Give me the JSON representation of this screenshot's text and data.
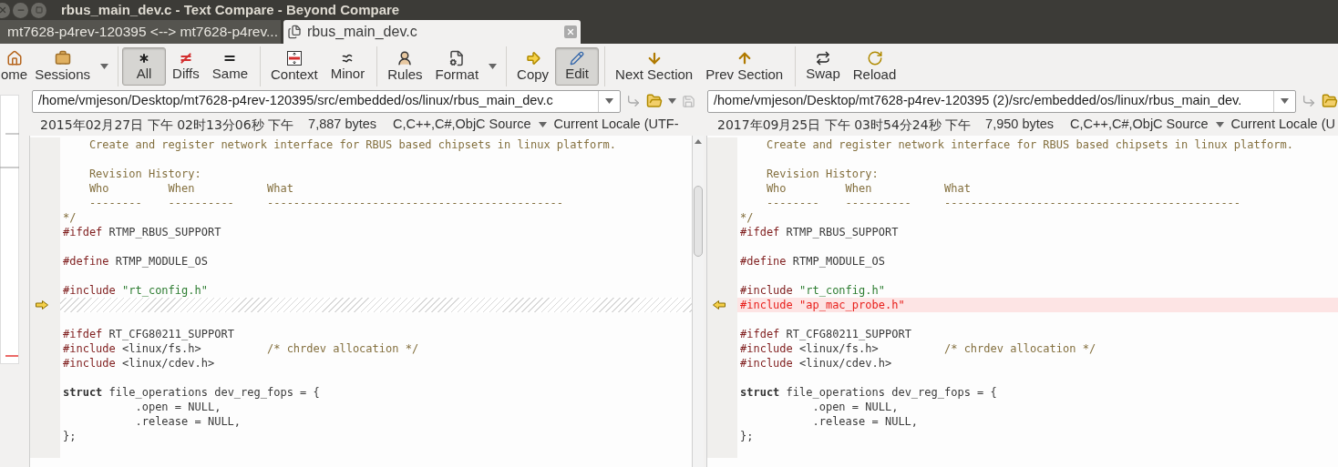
{
  "window": {
    "title": "rbus_main_dev.c - Text Compare - Beyond Compare"
  },
  "tabs": [
    {
      "label": "mt7628-p4rev-120395 <--> mt7628-p4rev...",
      "selected": false
    },
    {
      "label": "rbus_main_dev.c",
      "selected": true
    }
  ],
  "toolbar": {
    "groups": [
      [
        {
          "label": "ome",
          "selected": false,
          "dropdown": false
        },
        {
          "label": "Sessions",
          "selected": false,
          "dropdown": true
        }
      ],
      [
        {
          "label": "All",
          "selected": true,
          "dropdown": false
        },
        {
          "label": "Diffs",
          "selected": false,
          "dropdown": false
        },
        {
          "label": "Same",
          "selected": false,
          "dropdown": false
        }
      ],
      [
        {
          "label": "Context",
          "selected": false,
          "dropdown": false
        },
        {
          "label": "Minor",
          "selected": false,
          "dropdown": false
        }
      ],
      [
        {
          "label": "Rules",
          "selected": false,
          "dropdown": false
        },
        {
          "label": "Format",
          "selected": false,
          "dropdown": true
        }
      ],
      [
        {
          "label": "Copy",
          "selected": false,
          "dropdown": false
        },
        {
          "label": "Edit",
          "selected": true,
          "dropdown": false
        }
      ],
      [
        {
          "label": "Next Section",
          "selected": false,
          "dropdown": false
        },
        {
          "label": "Prev Section",
          "selected": false,
          "dropdown": false
        }
      ],
      [
        {
          "label": "Swap",
          "selected": false,
          "dropdown": false
        },
        {
          "label": "Reload",
          "selected": false,
          "dropdown": false
        }
      ]
    ]
  },
  "panes": [
    {
      "path": "/home/vmjeson/Desktop/mt7628-p4rev-120395/src/embedded/os/linux/rbus_main_dev.c",
      "date": "2015年02月27日 下午 02时13分06秒 下午",
      "size": "7,887 bytes",
      "format": "C,C++,C#,ObjC Source",
      "encoding": "Current Locale (UTF-",
      "lines": [
        {
          "kind": "code",
          "marker": false,
          "segments": [
            {
              "kind": "comment",
              "text": "    Create and register network interface for RBUS based chipsets in linux platform."
            }
          ]
        },
        {
          "kind": "blank",
          "marker": false
        },
        {
          "kind": "code",
          "marker": false,
          "segments": [
            {
              "kind": "comment",
              "text": "    Revision History:"
            }
          ]
        },
        {
          "kind": "code",
          "marker": false,
          "segments": [
            {
              "kind": "comment",
              "text": "    Who         When           What"
            }
          ]
        },
        {
          "kind": "code",
          "marker": false,
          "segments": [
            {
              "kind": "comment",
              "text": "    --------    ----------     ---------------------------------------------"
            }
          ]
        },
        {
          "kind": "code",
          "marker": false,
          "segments": [
            {
              "kind": "comment",
              "text": "*/"
            }
          ]
        },
        {
          "kind": "code",
          "marker": false,
          "segments": [
            {
              "kind": "directive",
              "text": "#ifdef"
            },
            {
              "kind": "plain",
              "text": " RTMP_RBUS_SUPPORT"
            }
          ]
        },
        {
          "kind": "blank",
          "marker": false
        },
        {
          "kind": "code",
          "marker": false,
          "segments": [
            {
              "kind": "directive",
              "text": "#define"
            },
            {
              "kind": "plain",
              "text": " RTMP_MODULE_OS"
            }
          ]
        },
        {
          "kind": "blank",
          "marker": false
        },
        {
          "kind": "code",
          "marker": false,
          "segments": [
            {
              "kind": "directive",
              "text": "#include"
            },
            {
              "kind": "string",
              "text": " \"rt_config.h\""
            }
          ]
        },
        {
          "kind": "missing",
          "marker": true
        },
        {
          "kind": "blank",
          "marker": false
        },
        {
          "kind": "code",
          "marker": false,
          "segments": [
            {
              "kind": "directive",
              "text": "#ifdef"
            },
            {
              "kind": "plain",
              "text": " RT_CFG80211_SUPPORT"
            }
          ]
        },
        {
          "kind": "code",
          "marker": false,
          "segments": [
            {
              "kind": "directive",
              "text": "#include"
            },
            {
              "kind": "plain",
              "text": " <linux/fs.h>          "
            },
            {
              "kind": "comment",
              "text": "/* chrdev allocation */"
            }
          ]
        },
        {
          "kind": "code",
          "marker": false,
          "segments": [
            {
              "kind": "directive",
              "text": "#include"
            },
            {
              "kind": "plain",
              "text": " <linux/cdev.h>"
            }
          ]
        },
        {
          "kind": "blank",
          "marker": false
        },
        {
          "kind": "code",
          "marker": false,
          "segments": [
            {
              "kind": "keyword",
              "text": "struct"
            },
            {
              "kind": "plain",
              "text": " file_operations dev_reg_fops = {"
            }
          ]
        },
        {
          "kind": "code",
          "marker": false,
          "segments": [
            {
              "kind": "plain",
              "text": "           .open = NULL,"
            }
          ]
        },
        {
          "kind": "code",
          "marker": false,
          "segments": [
            {
              "kind": "plain",
              "text": "           .release = NULL,"
            }
          ]
        },
        {
          "kind": "code",
          "marker": false,
          "segments": [
            {
              "kind": "plain",
              "text": "};"
            }
          ]
        },
        {
          "kind": "blank",
          "marker": false
        }
      ]
    },
    {
      "path": "/home/vmjeson/Desktop/mt7628-p4rev-120395 (2)/src/embedded/os/linux/rbus_main_dev.",
      "date": "2017年09月25日 下午 03时54分24秒 下午",
      "size": "7,950 bytes",
      "format": "C,C++,C#,ObjC Source",
      "encoding": "Current Locale (U",
      "lines": [
        {
          "kind": "code",
          "marker": false,
          "segments": [
            {
              "kind": "comment",
              "text": "    Create and register network interface for RBUS based chipsets in linux platform."
            }
          ]
        },
        {
          "kind": "blank",
          "marker": false
        },
        {
          "kind": "code",
          "marker": false,
          "segments": [
            {
              "kind": "comment",
              "text": "    Revision History:"
            }
          ]
        },
        {
          "kind": "code",
          "marker": false,
          "segments": [
            {
              "kind": "comment",
              "text": "    Who         When           What"
            }
          ]
        },
        {
          "kind": "code",
          "marker": false,
          "segments": [
            {
              "kind": "comment",
              "text": "    --------    ----------     ---------------------------------------------"
            }
          ]
        },
        {
          "kind": "code",
          "marker": false,
          "segments": [
            {
              "kind": "comment",
              "text": "*/"
            }
          ]
        },
        {
          "kind": "code",
          "marker": false,
          "segments": [
            {
              "kind": "directive",
              "text": "#ifdef"
            },
            {
              "kind": "plain",
              "text": " RTMP_RBUS_SUPPORT"
            }
          ]
        },
        {
          "kind": "blank",
          "marker": false
        },
        {
          "kind": "code",
          "marker": false,
          "segments": [
            {
              "kind": "directive",
              "text": "#define"
            },
            {
              "kind": "plain",
              "text": " RTMP_MODULE_OS"
            }
          ]
        },
        {
          "kind": "blank",
          "marker": false
        },
        {
          "kind": "code",
          "marker": false,
          "segments": [
            {
              "kind": "directive",
              "text": "#include"
            },
            {
              "kind": "string",
              "text": " \"rt_config.h\""
            }
          ]
        },
        {
          "kind": "added",
          "marker": true,
          "segments": [
            {
              "kind": "plain",
              "text": "#include \"ap_mac_probe.h\""
            }
          ]
        },
        {
          "kind": "blank",
          "marker": false
        },
        {
          "kind": "code",
          "marker": false,
          "segments": [
            {
              "kind": "directive",
              "text": "#ifdef"
            },
            {
              "kind": "plain",
              "text": " RT_CFG80211_SUPPORT"
            }
          ]
        },
        {
          "kind": "code",
          "marker": false,
          "segments": [
            {
              "kind": "directive",
              "text": "#include"
            },
            {
              "kind": "plain",
              "text": " <linux/fs.h>          "
            },
            {
              "kind": "comment",
              "text": "/* chrdev allocation */"
            }
          ]
        },
        {
          "kind": "code",
          "marker": false,
          "segments": [
            {
              "kind": "directive",
              "text": "#include"
            },
            {
              "kind": "plain",
              "text": " <linux/cdev.h>"
            }
          ]
        },
        {
          "kind": "blank",
          "marker": false
        },
        {
          "kind": "code",
          "marker": false,
          "segments": [
            {
              "kind": "keyword",
              "text": "struct"
            },
            {
              "kind": "plain",
              "text": " file_operations dev_reg_fops = {"
            }
          ]
        },
        {
          "kind": "code",
          "marker": false,
          "segments": [
            {
              "kind": "plain",
              "text": "           .open = NULL,"
            }
          ]
        },
        {
          "kind": "code",
          "marker": false,
          "segments": [
            {
              "kind": "plain",
              "text": "           .release = NULL,"
            }
          ]
        },
        {
          "kind": "code",
          "marker": false,
          "segments": [
            {
              "kind": "plain",
              "text": "};"
            }
          ]
        },
        {
          "kind": "blank",
          "marker": false
        }
      ]
    }
  ]
}
